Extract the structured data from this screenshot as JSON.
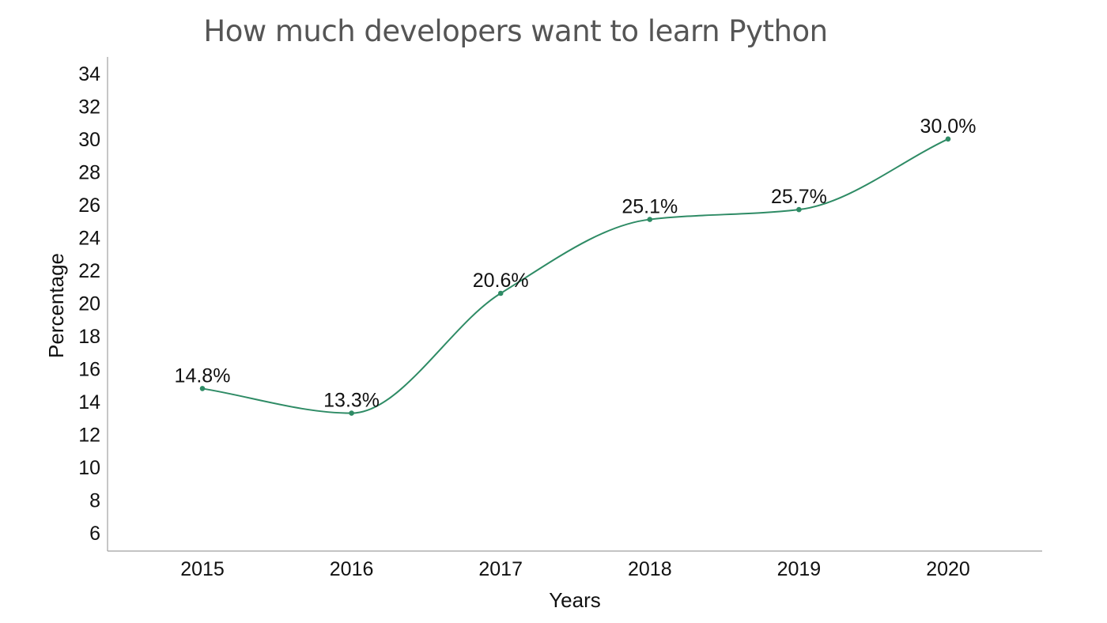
{
  "chart_data": {
    "type": "line",
    "title": "How much developers want to learn Python",
    "xlabel": "Years",
    "ylabel": "Percentage",
    "categories": [
      "2015",
      "2016",
      "2017",
      "2018",
      "2019",
      "2020"
    ],
    "series": [
      {
        "values": [
          14.8,
          13.3,
          20.6,
          25.1,
          25.7,
          30.0
        ],
        "data_labels": [
          "14.8%",
          "13.3%",
          "20.6%",
          "25.1%",
          "25.7%",
          "30.0%"
        ],
        "color": "#2e8b65"
      }
    ],
    "yticks": [
      "6",
      "8",
      "10",
      "12",
      "14",
      "16",
      "18",
      "20",
      "22",
      "24",
      "26",
      "28",
      "30",
      "32",
      "34"
    ],
    "ylim": [
      4.9,
      35
    ],
    "grid": false,
    "legend": "none",
    "line_style": "smooth"
  }
}
